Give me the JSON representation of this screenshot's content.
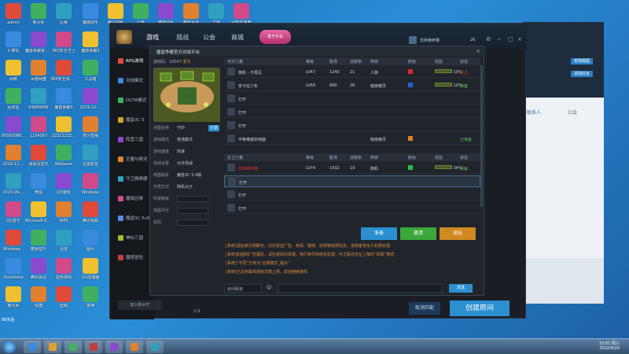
{
  "desktop": {
    "icons_col1": [
      "admin",
      "计算机",
      "网络",
      "回收站",
      "80000088...",
      "2019-12-...",
      "2020-09-...",
      "QQ音乐",
      "Windows...",
      "Quicktime",
      "鲁大师"
    ],
    "icons_col2": [
      "鲁大师",
      "魔兽争霸官方对战平台",
      "百度网盘",
      "99999999",
      "1234567",
      "网易云音乐",
      "微信",
      "Microsoft Edge",
      "酷我音乐",
      "腾讯会议",
      "快捷"
    ],
    "icons_col3": [
      "比赛",
      "360安全卫士",
      "360安全浏览器",
      "魔兽争霸3",
      "22222222...",
      "WeGame",
      "QQ游戏",
      "WPS",
      "迅雷",
      "蓝色游戏",
      "剪辑"
    ],
    "icons_col4": [
      "魔兽助手",
      "魔兽争霸3",
      "工具箱",
      "2019-12-...",
      "虎牙直播",
      "迅雷影音",
      "Windows",
      "腾讯视频",
      "图片",
      "UU加速器",
      "夜神"
    ],
    "icons_top": [
      "腾讯视频",
      "比赛",
      "魔兽助手",
      "魔兽对战",
      "文档",
      "VPN加速器"
    ]
  },
  "main_window": {
    "nav_tabs": [
      "游戏",
      "观战",
      "公会",
      "商城"
    ],
    "logo_text": "官方平台",
    "user_name": "优阿维伊赛",
    "coins": "26",
    "sidebar_items": [
      "RPG游戏",
      "对战模式",
      "DOTA模式",
      "魔兽3C 5",
      "阵营三国",
      "巨魔与精灵",
      "守卫雅典娜",
      "魔域召唤",
      "魔兽3C 5v5",
      "神仙三国",
      "魔塔冒险"
    ],
    "join_room_label": "加入新大厅",
    "pagination": "1/1",
    "cancel_match_label": "取消匹配",
    "create_room_label": "创建房间"
  },
  "dialog": {
    "title": "魔兽争霸官方对战平台",
    "close": "×",
    "game_code_label": "游戏码：16047",
    "game_code_value": "非凡",
    "form": [
      {
        "label": "地图名称",
        "value": "守护"
      },
      {
        "label": "游戏模式",
        "value": "普通模式"
      },
      {
        "label": "游戏速度",
        "value": "快速"
      },
      {
        "label": "观战设置",
        "value": "允许观战"
      },
      {
        "label": "地图版本",
        "value": "魔兽3C 5.4版"
      },
      {
        "label": "开局方式",
        "value": "随机大厅"
      },
      {
        "label": "所需等级",
        "value": ""
      },
      {
        "label": "地图评分",
        "value": ""
      },
      {
        "label": "密码",
        "value": ""
      }
    ],
    "copy_button": "分享",
    "team1": {
      "header": [
        "天灾力量",
        "等级",
        "胜场",
        "逃跑率",
        "种族",
        "颜色",
        "经验",
        "状态"
      ],
      "rows": [
        {
          "name": "随机 - 不再见",
          "level": "LV47",
          "wins": "1240",
          "rate": "21",
          "race": "人族",
          "color": "#d8262a",
          "exp": "10%",
          "status": "房主"
        },
        {
          "name": "安卡拉少年",
          "level": "LV56",
          "wins": "890",
          "rate": "28",
          "race": "暗夜精灵",
          "color": "#2060d8",
          "exp": "10%",
          "status": "准备"
        },
        {
          "name": "打开",
          "level": "",
          "wins": "",
          "rate": "",
          "race": "",
          "color": "",
          "exp": "",
          "status": ""
        },
        {
          "name": "打开",
          "level": "",
          "wins": "",
          "rate": "",
          "race": "",
          "color": "",
          "exp": "",
          "status": ""
        },
        {
          "name": "打开",
          "level": "",
          "wins": "",
          "rate": "",
          "race": "",
          "color": "",
          "exp": "",
          "status": ""
        },
        {
          "name": "中等难度的电脑",
          "level": "",
          "wins": "",
          "rate": "",
          "race": "暗夜精灵",
          "color": "#e08020",
          "exp": "",
          "status": "已准备"
        }
      ]
    },
    "team2": {
      "header": [
        "近卫力量",
        "等级",
        "胜场",
        "逃跑率",
        "种族",
        "颜色",
        "经验",
        "状态"
      ],
      "rows": [
        {
          "name": "优阿维伊赛",
          "level": "LV74",
          "wins": "1932",
          "rate": "19",
          "race": "随机",
          "color": "#28c040",
          "exp": "34%",
          "status": "准备"
        },
        {
          "name": "打开",
          "level": "",
          "wins": "",
          "rate": "",
          "race": "",
          "color": "",
          "exp": "",
          "status": ""
        },
        {
          "name": "打开",
          "level": "",
          "wins": "",
          "rate": "",
          "race": "",
          "color": "",
          "exp": "",
          "status": ""
        },
        {
          "name": "打开",
          "level": "",
          "wins": "",
          "rate": "",
          "race": "",
          "color": "",
          "exp": "",
          "status": ""
        }
      ]
    },
    "buttons": {
      "ready": "准备",
      "invite": "邀请",
      "exit": "退出"
    },
    "chat_lines": [
      "[系统]请玩家文明聊天，切勿发送广告、色情、赌博、违规等违规信息，违规者将永久封禁处理",
      "[系统]如遇到广告骚扰，请在游戏内举报，我们将尽快核实处理，可立即点击左上角的“举报”按钮",
      "[系统]“不同”分享为“比赛模式_提示”",
      "[系统]已达到最高游戏次数上限，欢迎继续游戏"
    ],
    "chat_channel": "房间频道",
    "send_label": "发送"
  },
  "back_window": {
    "tabs": [
      "联系人",
      "公会"
    ],
    "labels": [
      "帮我截图",
      "添加好友"
    ]
  },
  "taskbar": {
    "clock_time": "15:01 周三",
    "clock_date": "2022/4/20",
    "corner_label": "89天后"
  },
  "colors": {
    "accent_blue": "#2b8fd0",
    "ready_green": "#3aa83a",
    "exit_orange": "#d08a20",
    "highlight_red": "#e0302a"
  }
}
